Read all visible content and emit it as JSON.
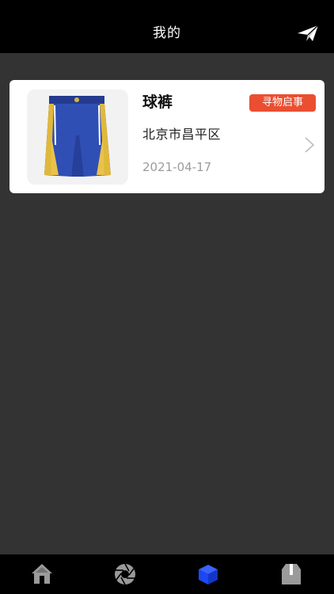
{
  "header": {
    "title": "我的",
    "action_icon": "paper-plane-icon"
  },
  "colors": {
    "header_bg": "#000000",
    "page_bg": "#333333",
    "badge_bg": "#ea4f31",
    "tab_active": "#1d47f5",
    "tab_inactive": "#9a9a9a"
  },
  "list": {
    "items": [
      {
        "title": "球裤",
        "tag": "寻物启事",
        "location": "北京市昌平区",
        "date": "2021-04-17",
        "image_icon": "basketball-shorts-image"
      }
    ]
  },
  "tabbar": {
    "tabs": [
      {
        "icon": "home-icon",
        "active": false
      },
      {
        "icon": "camera-aperture-icon",
        "active": false
      },
      {
        "icon": "cube-icon",
        "active": true
      },
      {
        "icon": "box-icon",
        "active": false
      }
    ]
  }
}
